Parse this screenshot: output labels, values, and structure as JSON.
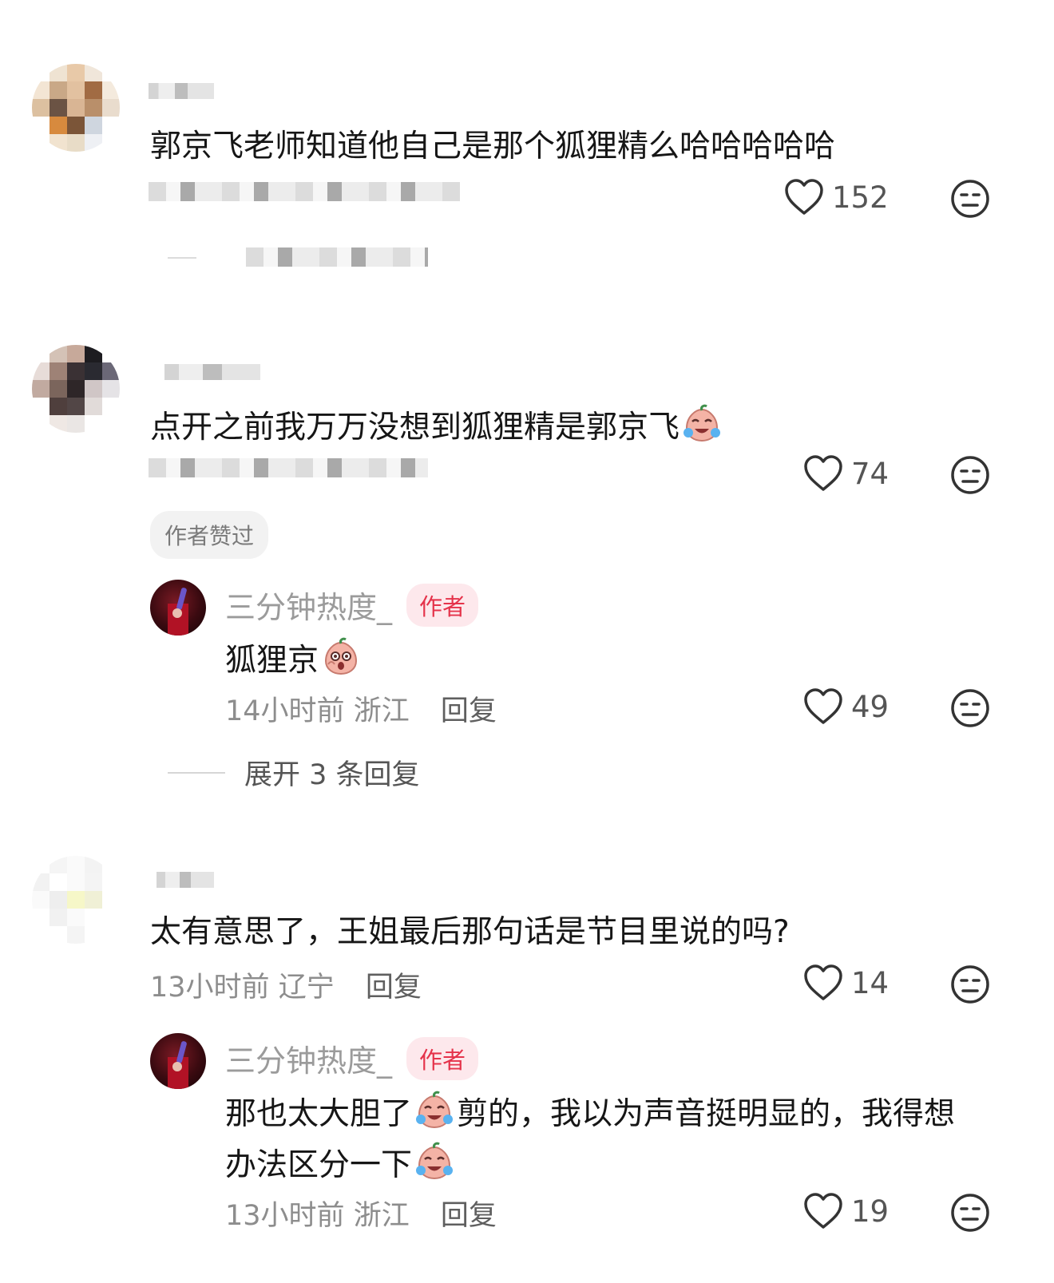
{
  "comments": [
    {
      "text": "郭京飞老师知道他自己是那个狐狸精么哈哈哈哈哈",
      "likes": "152"
    },
    {
      "text": "点开之前我万万没想到狐狸精是郭京飞",
      "likes": "74",
      "author_liked_label": "作者赞过",
      "reply": {
        "author": "三分钟热度_",
        "badge": "作者",
        "text": "狐狸京",
        "time": "14小时前",
        "location": "浙江",
        "reply_label": "回复",
        "likes": "49"
      },
      "expand_label": "展开 3 条回复"
    },
    {
      "text": "太有意思了，王姐最后那句话是节目里说的吗?",
      "time": "13小时前",
      "location": "辽宁",
      "reply_label": "回复",
      "likes": "14",
      "reply": {
        "author": "三分钟热度_",
        "badge": "作者",
        "text_line1a": "那也太大胆了",
        "text_line1b": "剪的，我以为声音挺明显的，我得想",
        "text_line2": "办法区分一下",
        "time": "13小时前",
        "location": "浙江",
        "reply_label": "回复",
        "likes": "19"
      }
    }
  ],
  "icons": {
    "like": "heart-outline-icon",
    "dislike": "neutral-face-icon",
    "emoji_cry": "crying-laughing-peach-emoji",
    "emoji_shock": "shocked-peach-emoji"
  }
}
